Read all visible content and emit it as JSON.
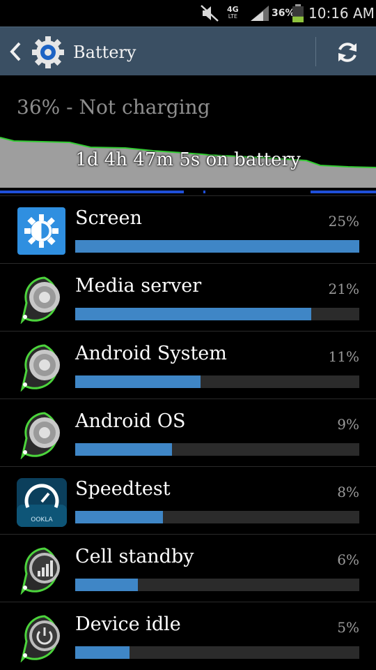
{
  "status_bar": {
    "network_badge_top": "4G",
    "network_badge_bottom": "LTE",
    "battery_percent": "36%",
    "battery_level": 0.36,
    "time": "10:16 AM",
    "icons": [
      "mute-icon",
      "4g-lte-icon",
      "signal-icon",
      "battery-icon"
    ]
  },
  "action_bar": {
    "title": "Battery",
    "back_icon": "chevron-left-icon",
    "app_icon": "settings-gear-icon",
    "refresh_icon": "refresh-icon",
    "background": "#3a4f63"
  },
  "summary": {
    "status_text": "36% - Not charging"
  },
  "graph": {
    "label": "1d 4h 47m 5s on battery",
    "line_color": "#33cc33",
    "fill_color": "#9e9e9e",
    "bar_color": "#1f4fd8"
  },
  "items": [
    {
      "name": "Screen",
      "percent": "25%",
      "value": 1.0,
      "icon": "screen-brightness-icon"
    },
    {
      "name": "Media server",
      "percent": "21%",
      "value": 0.83,
      "icon": "media-server-icon"
    },
    {
      "name": "Android System",
      "percent": "11%",
      "value": 0.44,
      "icon": "android-system-icon"
    },
    {
      "name": "Android OS",
      "percent": "9%",
      "value": 0.34,
      "icon": "android-os-icon"
    },
    {
      "name": "Speedtest",
      "percent": "8%",
      "value": 0.31,
      "icon": "speedtest-icon"
    },
    {
      "name": "Cell standby",
      "percent": "6%",
      "value": 0.22,
      "icon": "cell-standby-icon"
    },
    {
      "name": "Device idle",
      "percent": "5%",
      "value": 0.19,
      "icon": "device-idle-icon"
    }
  ],
  "colors": {
    "bar_fill": "#3f86c6",
    "bar_track": "#2b2b2b",
    "accent_green": "#33cc33"
  }
}
